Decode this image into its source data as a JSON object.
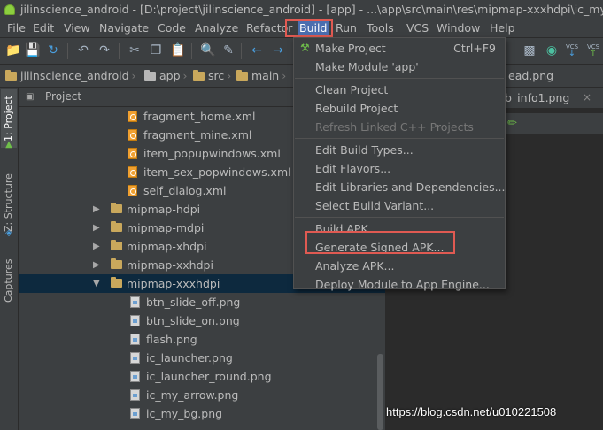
{
  "window": {
    "title": "jilinscience_android - [D:\\project\\jilinscience_android] - [app] - ...\\app\\src\\main\\res\\mipmap-xxxhdpi\\ic_my_head.png"
  },
  "menubar": {
    "items": [
      {
        "label": "File",
        "mnemonic": "F"
      },
      {
        "label": "Edit",
        "mnemonic": "E"
      },
      {
        "label": "View",
        "mnemonic": "V"
      },
      {
        "label": "Navigate",
        "mnemonic": "N"
      },
      {
        "label": "Code",
        "mnemonic": "C"
      },
      {
        "label": "Analyze",
        "mnemonic": "z"
      },
      {
        "label": "Refactor",
        "mnemonic": "R"
      },
      {
        "label": "Build",
        "mnemonic": "B",
        "active": true
      },
      {
        "label": "Run",
        "mnemonic": "u"
      },
      {
        "label": "Tools",
        "mnemonic": "T"
      },
      {
        "label": "VCS",
        "mnemonic": "S"
      },
      {
        "label": "Window",
        "mnemonic": "W"
      },
      {
        "label": "Help",
        "mnemonic": "H"
      }
    ]
  },
  "toolbar": {
    "vcs_label_1": "VCS",
    "vcs_label_2": "VCS"
  },
  "breadcrumb": {
    "items": [
      "jilinscience_android",
      "app",
      "src",
      "main"
    ],
    "trailing_fragment": "ead.png"
  },
  "toolstrip": {
    "tabs": [
      "1: Project",
      "Z: Structure",
      "Captures"
    ]
  },
  "project_panel": {
    "header_label": "Project",
    "rows": [
      {
        "type": "xml",
        "label": "fragment_home.xml"
      },
      {
        "type": "xml",
        "label": "fragment_mine.xml"
      },
      {
        "type": "xml",
        "label": "item_popupwindows.xml"
      },
      {
        "type": "xml",
        "label": "item_sex_popwindows.xml"
      },
      {
        "type": "xml",
        "label": "self_dialog.xml"
      },
      {
        "type": "dir",
        "label": "mipmap-hdpi",
        "expanded": false
      },
      {
        "type": "dir",
        "label": "mipmap-mdpi",
        "expanded": false
      },
      {
        "type": "dir",
        "label": "mipmap-xhdpi",
        "expanded": false
      },
      {
        "type": "dir",
        "label": "mipmap-xxhdpi",
        "expanded": false
      },
      {
        "type": "dir",
        "label": "mipmap-xxxhdpi",
        "expanded": true,
        "selected": true
      },
      {
        "type": "png",
        "label": "btn_slide_off.png"
      },
      {
        "type": "png",
        "label": "btn_slide_on.png"
      },
      {
        "type": "png",
        "label": "flash.png"
      },
      {
        "type": "png",
        "label": "ic_launcher.png"
      },
      {
        "type": "png",
        "label": "ic_launcher_round.png"
      },
      {
        "type": "png",
        "label": "ic_my_arrow.png"
      },
      {
        "type": "png",
        "label": "ic_my_bg.png"
      }
    ]
  },
  "editor": {
    "tab_label": "b_info1.png"
  },
  "build_menu": {
    "groups": [
      [
        {
          "label": "Make Project",
          "shortcut": "Ctrl+F9",
          "icon": "hammer-icon"
        },
        {
          "label": "Make Module 'app'"
        }
      ],
      [
        {
          "label": "Clean Project"
        },
        {
          "label": "Rebuild Project"
        },
        {
          "label": "Refresh Linked C++ Projects",
          "disabled": true
        }
      ],
      [
        {
          "label": "Edit Build Types..."
        },
        {
          "label": "Edit Flavors..."
        },
        {
          "label": "Edit Libraries and Dependencies..."
        },
        {
          "label": "Select Build Variant..."
        }
      ],
      [
        {
          "label": "Build APK"
        },
        {
          "label": "Generate Signed APK...",
          "highlighted": true
        },
        {
          "label": "Analyze APK..."
        },
        {
          "label": "Deploy Module to App Engine..."
        }
      ]
    ]
  },
  "watermark": "https://blog.csdn.net/u010221508",
  "colors": {
    "menu_active": "#4b6eaf",
    "highlight_box": "#e05a52",
    "selection": "#0d293e"
  }
}
